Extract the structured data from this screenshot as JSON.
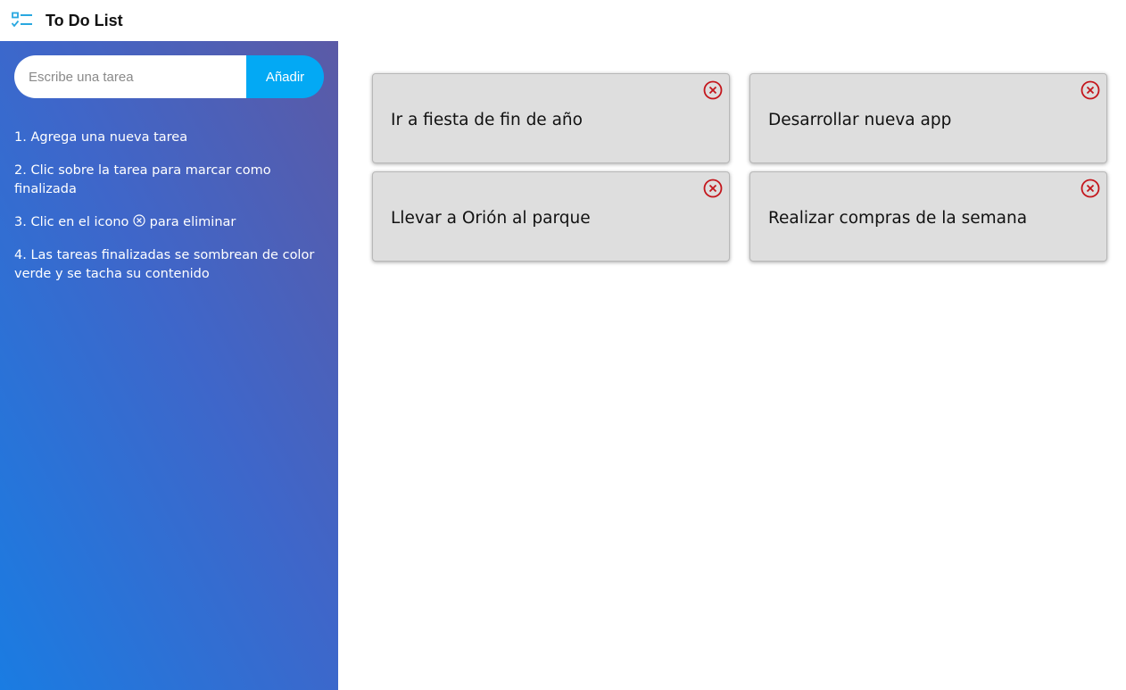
{
  "header": {
    "title": "To Do List",
    "logo_icon": "checklist-icon",
    "accent_color": "#29a8e0"
  },
  "sidebar": {
    "input": {
      "placeholder": "Escribe una tarea",
      "value": ""
    },
    "add_button_label": "Añadir",
    "add_button_color": "#03a9f4",
    "instructions": [
      {
        "before": "1. Agrega una nueva tarea",
        "after": ""
      },
      {
        "before": "2. Clic sobre la tarea para marcar como finalizada",
        "after": ""
      },
      {
        "before": "3. Clic en el icono ",
        "icon": "close-circle-icon",
        "after": " para eliminar"
      },
      {
        "before": "4. Las tareas finalizadas se sombrean de color verde y se tacha su contenido",
        "after": ""
      }
    ]
  },
  "tasks": [
    {
      "text": "Ir a fiesta de fin de año",
      "delete_icon": "close-circle-icon"
    },
    {
      "text": "Desarrollar nueva app",
      "delete_icon": "close-circle-icon"
    },
    {
      "text": "Llevar a Orión al parque",
      "delete_icon": "close-circle-icon"
    },
    {
      "text": "Realizar compras de la semana",
      "delete_icon": "close-circle-icon"
    }
  ],
  "colors": {
    "delete_icon": "#c4161c",
    "task_background": "#dedede"
  }
}
